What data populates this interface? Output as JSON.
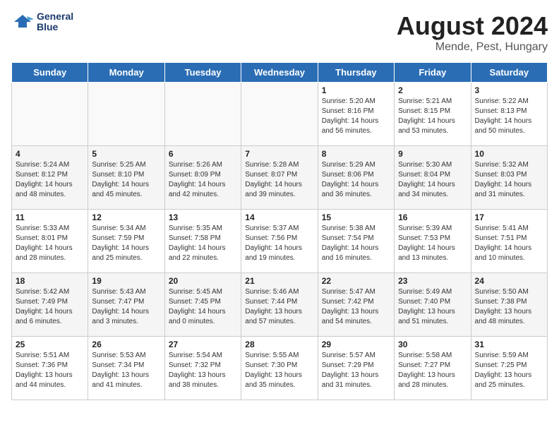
{
  "header": {
    "logo_line1": "General",
    "logo_line2": "Blue",
    "title": "August 2024",
    "subtitle": "Mende, Pest, Hungary"
  },
  "days_of_week": [
    "Sunday",
    "Monday",
    "Tuesday",
    "Wednesday",
    "Thursday",
    "Friday",
    "Saturday"
  ],
  "weeks": [
    [
      {
        "day": "",
        "info": ""
      },
      {
        "day": "",
        "info": ""
      },
      {
        "day": "",
        "info": ""
      },
      {
        "day": "",
        "info": ""
      },
      {
        "day": "1",
        "info": "Sunrise: 5:20 AM\nSunset: 8:16 PM\nDaylight: 14 hours\nand 56 minutes."
      },
      {
        "day": "2",
        "info": "Sunrise: 5:21 AM\nSunset: 8:15 PM\nDaylight: 14 hours\nand 53 minutes."
      },
      {
        "day": "3",
        "info": "Sunrise: 5:22 AM\nSunset: 8:13 PM\nDaylight: 14 hours\nand 50 minutes."
      }
    ],
    [
      {
        "day": "4",
        "info": "Sunrise: 5:24 AM\nSunset: 8:12 PM\nDaylight: 14 hours\nand 48 minutes."
      },
      {
        "day": "5",
        "info": "Sunrise: 5:25 AM\nSunset: 8:10 PM\nDaylight: 14 hours\nand 45 minutes."
      },
      {
        "day": "6",
        "info": "Sunrise: 5:26 AM\nSunset: 8:09 PM\nDaylight: 14 hours\nand 42 minutes."
      },
      {
        "day": "7",
        "info": "Sunrise: 5:28 AM\nSunset: 8:07 PM\nDaylight: 14 hours\nand 39 minutes."
      },
      {
        "day": "8",
        "info": "Sunrise: 5:29 AM\nSunset: 8:06 PM\nDaylight: 14 hours\nand 36 minutes."
      },
      {
        "day": "9",
        "info": "Sunrise: 5:30 AM\nSunset: 8:04 PM\nDaylight: 14 hours\nand 34 minutes."
      },
      {
        "day": "10",
        "info": "Sunrise: 5:32 AM\nSunset: 8:03 PM\nDaylight: 14 hours\nand 31 minutes."
      }
    ],
    [
      {
        "day": "11",
        "info": "Sunrise: 5:33 AM\nSunset: 8:01 PM\nDaylight: 14 hours\nand 28 minutes."
      },
      {
        "day": "12",
        "info": "Sunrise: 5:34 AM\nSunset: 7:59 PM\nDaylight: 14 hours\nand 25 minutes."
      },
      {
        "day": "13",
        "info": "Sunrise: 5:35 AM\nSunset: 7:58 PM\nDaylight: 14 hours\nand 22 minutes."
      },
      {
        "day": "14",
        "info": "Sunrise: 5:37 AM\nSunset: 7:56 PM\nDaylight: 14 hours\nand 19 minutes."
      },
      {
        "day": "15",
        "info": "Sunrise: 5:38 AM\nSunset: 7:54 PM\nDaylight: 14 hours\nand 16 minutes."
      },
      {
        "day": "16",
        "info": "Sunrise: 5:39 AM\nSunset: 7:53 PM\nDaylight: 14 hours\nand 13 minutes."
      },
      {
        "day": "17",
        "info": "Sunrise: 5:41 AM\nSunset: 7:51 PM\nDaylight: 14 hours\nand 10 minutes."
      }
    ],
    [
      {
        "day": "18",
        "info": "Sunrise: 5:42 AM\nSunset: 7:49 PM\nDaylight: 14 hours\nand 6 minutes."
      },
      {
        "day": "19",
        "info": "Sunrise: 5:43 AM\nSunset: 7:47 PM\nDaylight: 14 hours\nand 3 minutes."
      },
      {
        "day": "20",
        "info": "Sunrise: 5:45 AM\nSunset: 7:45 PM\nDaylight: 14 hours\nand 0 minutes."
      },
      {
        "day": "21",
        "info": "Sunrise: 5:46 AM\nSunset: 7:44 PM\nDaylight: 13 hours\nand 57 minutes."
      },
      {
        "day": "22",
        "info": "Sunrise: 5:47 AM\nSunset: 7:42 PM\nDaylight: 13 hours\nand 54 minutes."
      },
      {
        "day": "23",
        "info": "Sunrise: 5:49 AM\nSunset: 7:40 PM\nDaylight: 13 hours\nand 51 minutes."
      },
      {
        "day": "24",
        "info": "Sunrise: 5:50 AM\nSunset: 7:38 PM\nDaylight: 13 hours\nand 48 minutes."
      }
    ],
    [
      {
        "day": "25",
        "info": "Sunrise: 5:51 AM\nSunset: 7:36 PM\nDaylight: 13 hours\nand 44 minutes."
      },
      {
        "day": "26",
        "info": "Sunrise: 5:53 AM\nSunset: 7:34 PM\nDaylight: 13 hours\nand 41 minutes."
      },
      {
        "day": "27",
        "info": "Sunrise: 5:54 AM\nSunset: 7:32 PM\nDaylight: 13 hours\nand 38 minutes."
      },
      {
        "day": "28",
        "info": "Sunrise: 5:55 AM\nSunset: 7:30 PM\nDaylight: 13 hours\nand 35 minutes."
      },
      {
        "day": "29",
        "info": "Sunrise: 5:57 AM\nSunset: 7:29 PM\nDaylight: 13 hours\nand 31 minutes."
      },
      {
        "day": "30",
        "info": "Sunrise: 5:58 AM\nSunset: 7:27 PM\nDaylight: 13 hours\nand 28 minutes."
      },
      {
        "day": "31",
        "info": "Sunrise: 5:59 AM\nSunset: 7:25 PM\nDaylight: 13 hours\nand 25 minutes."
      }
    ]
  ]
}
